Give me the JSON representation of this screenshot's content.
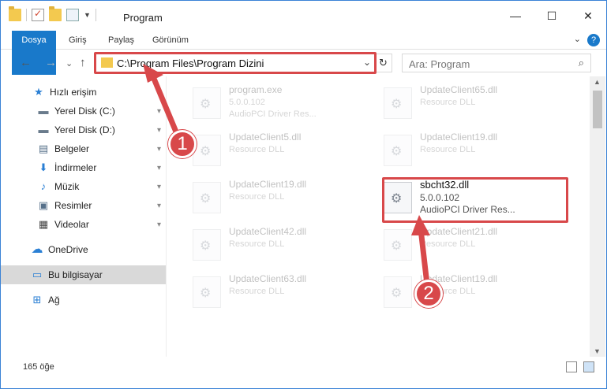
{
  "window": {
    "title": "Program",
    "controls": {
      "minimize": "—",
      "maximize": "☐",
      "close": "✕"
    }
  },
  "ribbon": {
    "tabs": [
      "Dosya",
      "Giriş",
      "Paylaş",
      "Görünüm"
    ],
    "expand": "⌄",
    "help": "?"
  },
  "nav": {
    "back": "←",
    "forward": "→",
    "recent": "⌄",
    "up": "↑",
    "address": "C:\\Program Files\\Program Dizini",
    "address_dropdown": "⌄",
    "refresh": "↻",
    "search_placeholder": "Ara: Program",
    "search_icon": "⌕"
  },
  "sidebar": {
    "items": [
      {
        "label": "Hızlı erişim",
        "icon": "star-icon",
        "glyph": "★",
        "pinned": false
      },
      {
        "label": "Yerel Disk (C:)",
        "icon": "drive-icon",
        "glyph": "▬",
        "pinned": true
      },
      {
        "label": "Yerel Disk (D:)",
        "icon": "drive-icon",
        "glyph": "▬",
        "pinned": true
      },
      {
        "label": "Belgeler",
        "icon": "documents-icon",
        "glyph": "▤",
        "pinned": true
      },
      {
        "label": "İndirmeler",
        "icon": "downloads-icon",
        "glyph": "⬇",
        "pinned": true
      },
      {
        "label": "Müzik",
        "icon": "music-icon",
        "glyph": "♪",
        "pinned": true
      },
      {
        "label": "Resimler",
        "icon": "pictures-icon",
        "glyph": "▣",
        "pinned": true
      },
      {
        "label": "Videolar",
        "icon": "videos-icon",
        "glyph": "▦",
        "pinned": true
      },
      {
        "label": "OneDrive",
        "icon": "cloud-icon",
        "glyph": "☁",
        "pinned": false
      },
      {
        "label": "Bu bilgisayar",
        "icon": "computer-icon",
        "glyph": "▭",
        "pinned": false
      },
      {
        "label": "Ağ",
        "icon": "network-icon",
        "glyph": "⊞",
        "pinned": false
      }
    ],
    "pin_glyph": "📌"
  },
  "files": [
    {
      "name": "program.exe",
      "line2": "5.0.0.102",
      "line3": "AudioPCI Driver Res..."
    },
    {
      "name": "UpdateClient65.dll",
      "line2": "Resource DLL",
      "line3": ""
    },
    {
      "name": "UpdateClient5.dll",
      "line2": "Resource DLL",
      "line3": ""
    },
    {
      "name": "UpdateClient19.dll",
      "line2": "Resource DLL",
      "line3": ""
    },
    {
      "name": "UpdateClient19.dll",
      "line2": "Resource DLL",
      "line3": ""
    },
    {
      "name": "sbcht32.dll",
      "line2": "5.0.0.102",
      "line3": "AudioPCI Driver Res..."
    },
    {
      "name": "UpdateClient42.dll",
      "line2": "Resource DLL",
      "line3": ""
    },
    {
      "name": "UpdateClient21.dll",
      "line2": "Resource DLL",
      "line3": ""
    },
    {
      "name": "UpdateClient63.dll",
      "line2": "Resource DLL",
      "line3": ""
    },
    {
      "name": "UpdateClient19.dll",
      "line2": "Resource DLL",
      "line3": ""
    }
  ],
  "status": {
    "count": "165 öğe"
  },
  "annotations": {
    "badge1": "1",
    "badge2": "2",
    "color": "#d8484a"
  },
  "colors": {
    "accent": "#1979ca",
    "highlight": "#d8484a",
    "folder": "#f3c94f"
  }
}
